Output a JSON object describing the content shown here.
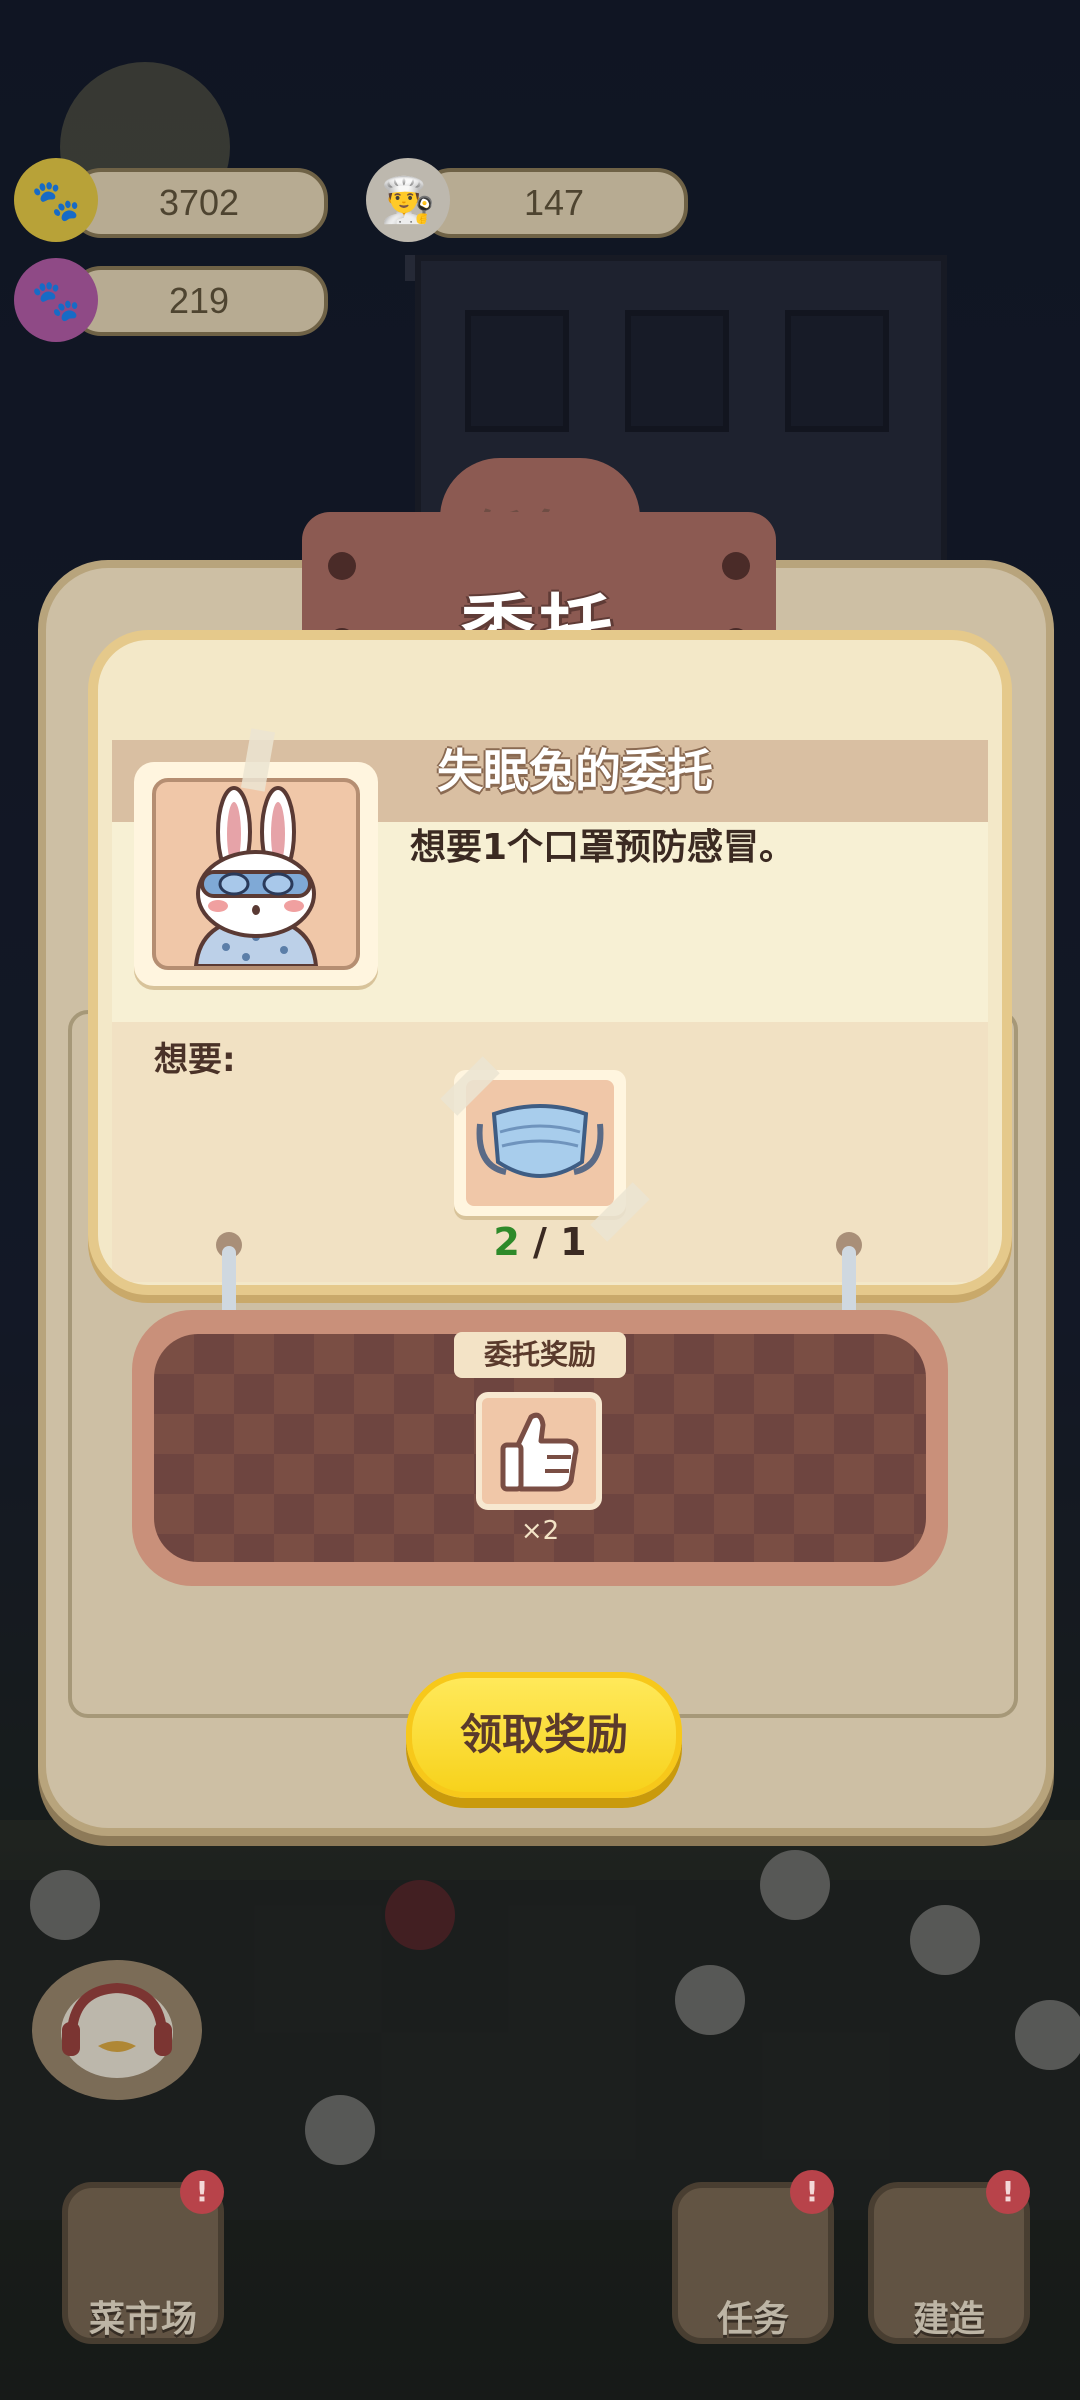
{
  "hud": {
    "coins": "3702",
    "chef": "147",
    "paws": "219"
  },
  "background_tab": "任务",
  "modal": {
    "title": "委托",
    "quest_title": "失眠兔的委托",
    "description": "想要1个口罩预防感冒。",
    "want_label": "想要:",
    "item_name": "mask",
    "count_have": "2",
    "count_sep": " / ",
    "count_need": "1",
    "reward_label": "委托奖励",
    "reward_qty": "×2",
    "claim_button": "领取奖励"
  },
  "nav": {
    "market": "菜市场",
    "tasks": "任务",
    "build": "建造",
    "badge": "!"
  },
  "colors": {
    "claim_button": "#f7d21c",
    "title_plate": "#8c5a52",
    "card_bg": "#f3e8c8",
    "count_have": "#2e8a2a"
  }
}
